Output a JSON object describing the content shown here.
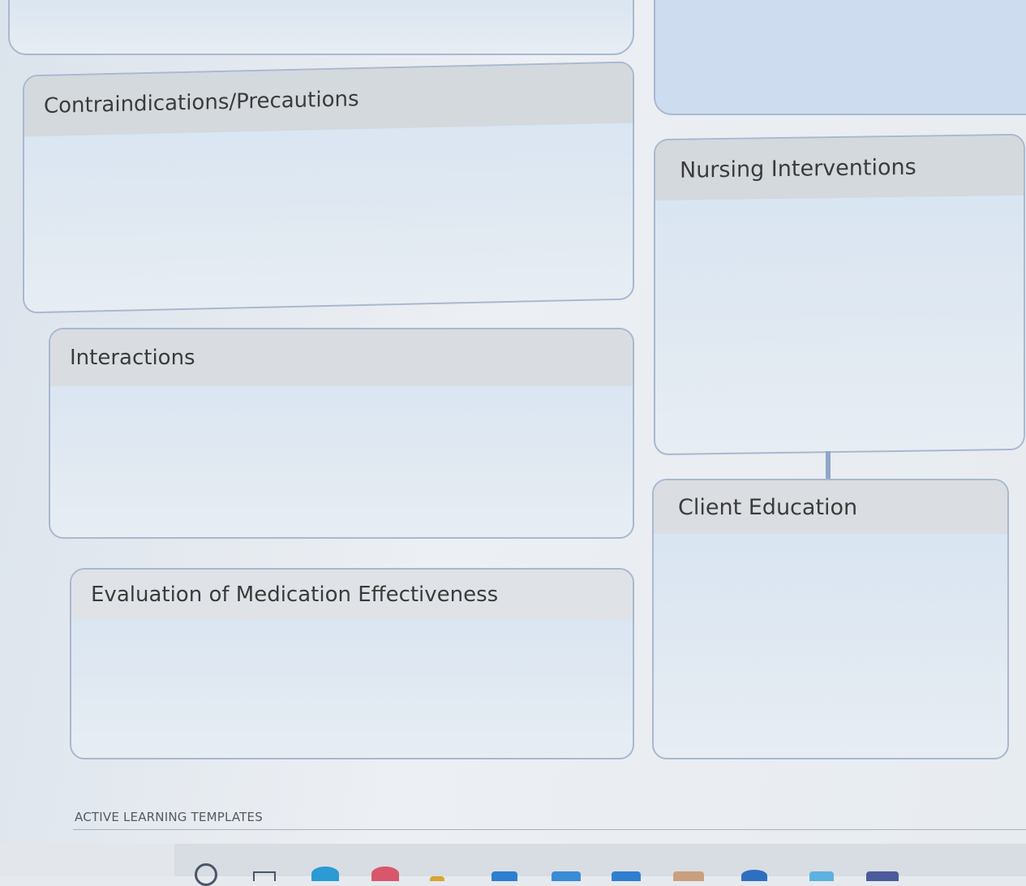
{
  "template": {
    "sections": {
      "contraindications": {
        "title": "Contraindications/Precautions",
        "content": ""
      },
      "interactions": {
        "title": "Interactions",
        "content": ""
      },
      "evaluation": {
        "title": "Evaluation of Medication Effectiveness",
        "content": ""
      },
      "nursing_interventions": {
        "title": "Nursing Interventions",
        "content": ""
      },
      "client_education": {
        "title": "Client Education",
        "content": ""
      }
    },
    "footer_label": "ACTIVE LEARNING TEMPLATES"
  },
  "taskbar": {
    "icons": [
      "search-icon",
      "task-view-icon",
      "edge-icon",
      "chrome-icon",
      "file-explorer-icon",
      "store-icon",
      "app-icon",
      "app-icon",
      "app-icon",
      "app-icon",
      "app-icon",
      "app-icon"
    ]
  }
}
